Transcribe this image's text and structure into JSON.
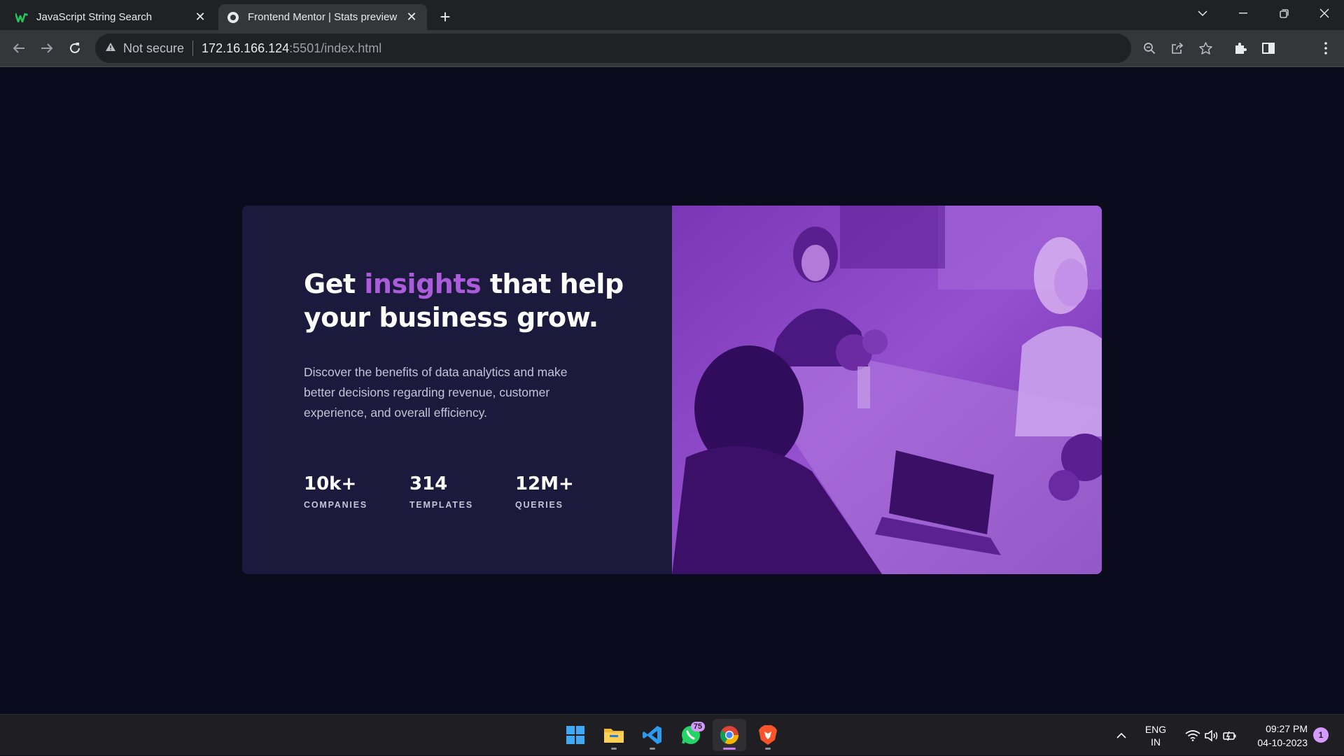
{
  "browser": {
    "tabs": [
      {
        "title": "JavaScript String Search",
        "active": false,
        "favicon": "w-logo-icon"
      },
      {
        "title": "Frontend Mentor | Stats preview",
        "active": true,
        "favicon": "globe-icon"
      }
    ],
    "address": {
      "security_label": "Not secure",
      "host": "172.16.166.124",
      "path": ":5501/index.html"
    }
  },
  "card": {
    "headline_before": "Get ",
    "headline_accent": "insights",
    "headline_after": " that help your business grow.",
    "description": "Discover the benefits of data analytics and make better decisions regarding revenue, customer experience, and overall efficiency.",
    "stats": [
      {
        "value": "10k+",
        "label": "COMPANIES"
      },
      {
        "value": "314",
        "label": "TEMPLATES"
      },
      {
        "value": "12M+",
        "label": "QUERIES"
      }
    ],
    "colors": {
      "accent": "#aa5cdb",
      "card_bg": "#1c1a3c",
      "page_bg": "#0a0c1d",
      "image_tint": "#8a3fc8"
    }
  },
  "taskbar": {
    "apps": [
      {
        "name": "windows-start-icon"
      },
      {
        "name": "file-explorer-icon"
      },
      {
        "name": "vscode-icon"
      },
      {
        "name": "whatsapp-icon",
        "badge": "75"
      },
      {
        "name": "chrome-icon"
      },
      {
        "name": "brave-icon"
      }
    ],
    "language_line1": "ENG",
    "language_line2": "IN",
    "time": "09:27 PM",
    "date": "04-10-2023",
    "notifications": "1"
  }
}
